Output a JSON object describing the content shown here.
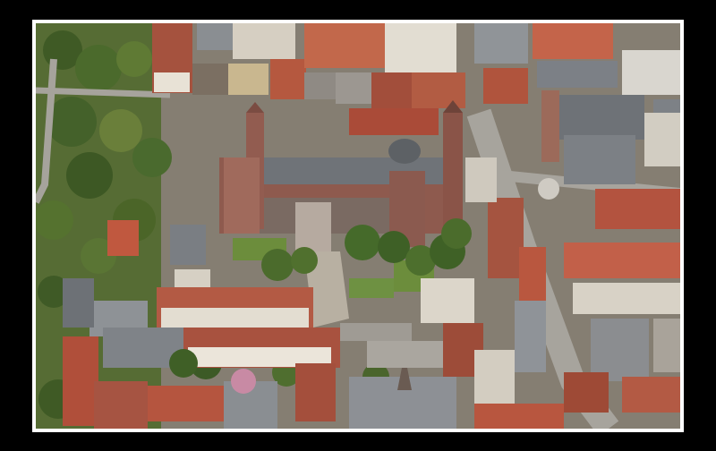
{
  "image": {
    "subject": "aerial-photo",
    "border_color": "#000000",
    "mat_color": "#ffffff"
  },
  "palette": {
    "roof_red": "#a5523e",
    "roof_grey": "#6f7378",
    "sandstone": "#8e5a4e",
    "tree_green": "#4f6a2e",
    "street": "#a09d96",
    "lawn": "#6c8d3c",
    "plaza": "#b8b0a2"
  }
}
